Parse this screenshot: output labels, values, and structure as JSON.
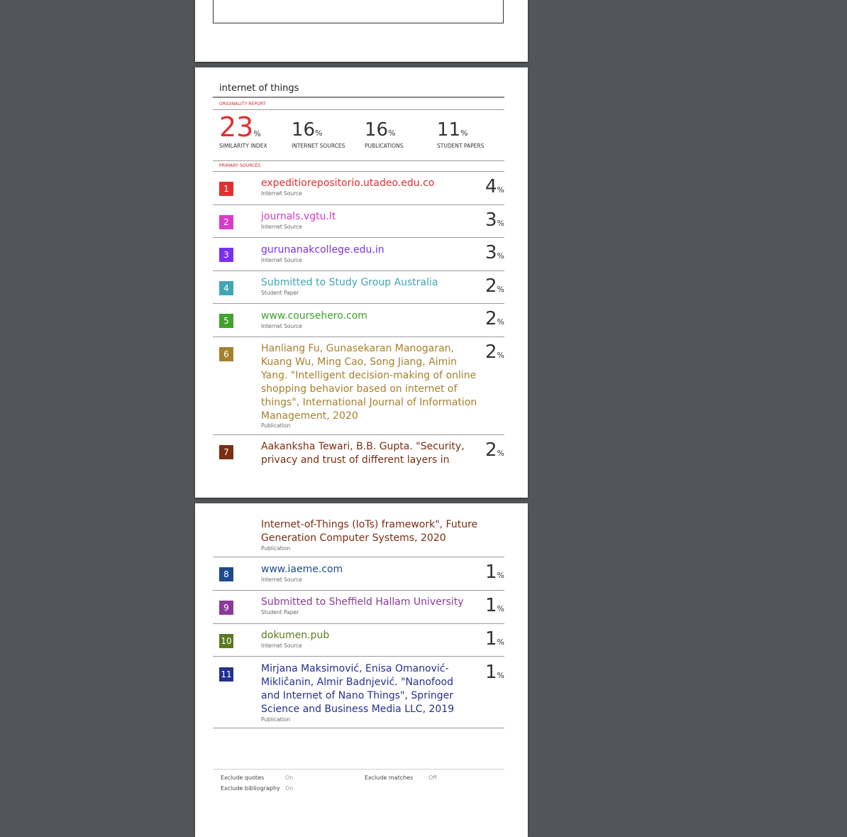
{
  "doc_title": "internet of things",
  "originality_label": "ORIGINALITY REPORT",
  "primary_label": "PRIMARY SOURCES",
  "stats": [
    {
      "value": "23",
      "unit": "%",
      "label": "SIMILARITY INDEX"
    },
    {
      "value": "16",
      "unit": "%",
      "label": "INTERNET SOURCES"
    },
    {
      "value": "16",
      "unit": "%",
      "label": "PUBLICATIONS"
    },
    {
      "value": "11",
      "unit": "%",
      "label": "STUDENT PAPERS"
    }
  ],
  "sources": [
    {
      "num": "1",
      "color": "#e2302f",
      "title": "expeditiorepositorio.utadeo.edu.co",
      "type": "Internet Source",
      "pct": "4"
    },
    {
      "num": "2",
      "color": "#d63ac9",
      "title": "journals.vgtu.lt",
      "type": "Internet Source",
      "pct": "3"
    },
    {
      "num": "3",
      "color": "#7b2ff0",
      "title": "gurunanakcollege.edu.in",
      "type": "Internet Source",
      "pct": "3"
    },
    {
      "num": "4",
      "color": "#3fa6b4",
      "title": "Submitted to Study Group Australia",
      "type": "Student Paper",
      "pct": "2"
    },
    {
      "num": "5",
      "color": "#3ea22d",
      "title": "www.coursehero.com",
      "type": "Internet Source",
      "pct": "2"
    },
    {
      "num": "6",
      "color": "#a7802d",
      "title": "Hanliang Fu, Gunasekaran Manogaran, Kuang Wu, Ming Cao, Song Jiang, Aimin Yang. \"Intelligent decision-making of online shopping behavior based on internet of things\", International Journal of Information Management, 2020",
      "type": "Publication",
      "pct": "2"
    },
    {
      "num": "7",
      "color": "#7a2e12",
      "title": "Aakanksha Tewari, B.B. Gupta. \"Security, privacy and trust of different layers in",
      "pct": "2"
    },
    {
      "continued_text": "Internet-of-Things (IoTs) framework\", Future Generation Computer Systems, 2020",
      "color": "#7a2e12",
      "type": "Publication"
    },
    {
      "num": "8",
      "color": "#1e4a8e",
      "title": "www.iaeme.com",
      "type": "Internet Source",
      "pct": "1"
    },
    {
      "num": "9",
      "color": "#8a3a98",
      "title": "Submitted to Sheffield Hallam University",
      "type": "Student Paper",
      "pct": "1"
    },
    {
      "num": "10",
      "color": "#5a7a1e",
      "title": "dokumen.pub",
      "type": "Internet Source",
      "pct": "1"
    },
    {
      "num": "11",
      "color": "#23308f",
      "title": "Mirjana Maksimović, Enisa Omanović-Mikličanin, Almir Badnjević. \"Nanofood and Internet of Nano Things\", Springer Science and Business Media LLC, 2019",
      "type": "Publication",
      "pct": "1"
    }
  ],
  "pct_sign": "%",
  "footer": {
    "exclude_quotes_label": "Exclude quotes",
    "exclude_quotes_value": "On",
    "exclude_bib_label": "Exclude bibliography",
    "exclude_bib_value": "On",
    "exclude_matches_label": "Exclude matches",
    "exclude_matches_value": "Off"
  }
}
